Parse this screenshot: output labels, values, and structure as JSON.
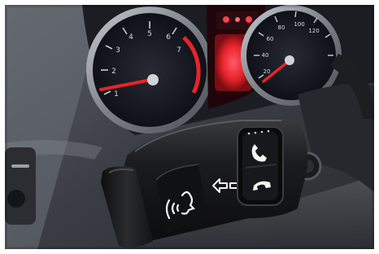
{
  "photo": {
    "subject": "car steering column stalk with voice-control, phone answer and phone hang-up buttons in front of an instrument cluster",
    "icons": [
      "voice-command-icon",
      "arrows-left-right-icon",
      "phone-answer-icon",
      "phone-hangup-icon"
    ],
    "colors": {
      "needle": "#e8232a",
      "cluster_glow": "#ff2a3a",
      "dash_plastic": "#3a3d44",
      "stalk_black": "#141416",
      "gauge_face": "#15181f",
      "gauge_ring": "#9aa0a8"
    },
    "gauge_left": {
      "scale_labels": [
        "1",
        "2",
        "3",
        "4",
        "5",
        "6",
        "7"
      ]
    },
    "gauge_right": {
      "scale_labels": [
        "20",
        "40",
        "60",
        "80",
        "100",
        "120"
      ]
    }
  }
}
